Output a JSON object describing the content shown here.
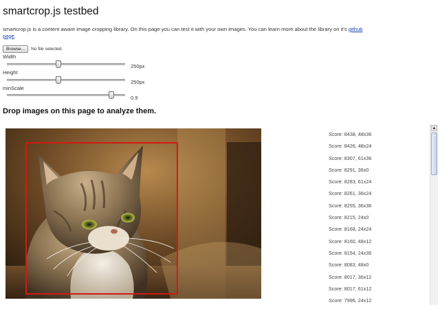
{
  "page": {
    "title": "smartcrop.js testbed",
    "intro_text": "smartcrop.js is a content aware image cropping library. On this page you can test it with your own images. You can learn more about the library on it's",
    "intro_link": "github page",
    "intro_end": "."
  },
  "file_input": {
    "button_label": "Browse...",
    "status": "No file selected."
  },
  "sliders": [
    {
      "label": "Width",
      "value": "250px",
      "level": 0.43
    },
    {
      "label": "Height",
      "value": "250px",
      "level": 0.43
    },
    {
      "label": "minScale",
      "value": "0.9",
      "level": 0.9
    }
  ],
  "drop_heading": "Drop images on this page to analyze them.",
  "scores": [
    "Score: 8438, 48x36",
    "Score: 8426, 48x24",
    "Score: 8307, 61x36",
    "Score: 8291, 36x0",
    "Score: 8283, 61x24",
    "Score: 8261, 36x24",
    "Score: 8255, 36x36",
    "Score: 8215, 24x0",
    "Score: 8168, 24x24",
    "Score: 8160, 48x12",
    "Score: 8154, 24x36",
    "Score: 8083, 48x0",
    "Score: 8017, 36x12",
    "Score: 8017, 61x12",
    "Score: 7996, 24x12"
  ],
  "colors": {
    "crop_border": "#d21a12",
    "link": "#1a3fb8"
  },
  "icons": {
    "scroll_up": "chevron-up-icon"
  }
}
